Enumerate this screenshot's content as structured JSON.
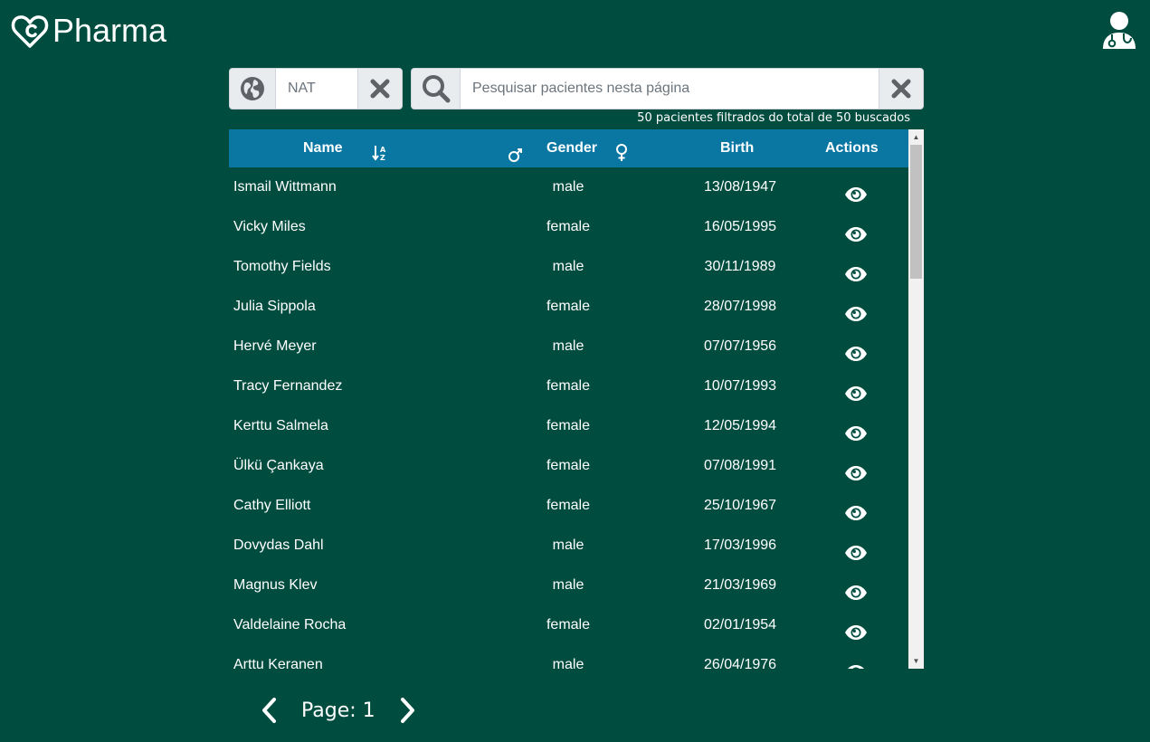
{
  "app": {
    "title": "Pharma"
  },
  "filters": {
    "country_value": "NAT",
    "search_placeholder": "Pesquisar pacientes nesta página"
  },
  "status": {
    "count_text": "50 pacientes filtrados do total de 50 buscados"
  },
  "table": {
    "headers": {
      "name": "Name",
      "gender": "Gender",
      "birth": "Birth",
      "actions": "Actions"
    },
    "rows": [
      {
        "name": "Ismail Wittmann",
        "gender": "male",
        "birth": "13/08/1947"
      },
      {
        "name": "Vicky Miles",
        "gender": "female",
        "birth": "16/05/1995"
      },
      {
        "name": "Tomothy Fields",
        "gender": "male",
        "birth": "30/11/1989"
      },
      {
        "name": "Julia Sippola",
        "gender": "female",
        "birth": "28/07/1998"
      },
      {
        "name": "Hervé Meyer",
        "gender": "male",
        "birth": "07/07/1956"
      },
      {
        "name": "Tracy Fernandez",
        "gender": "female",
        "birth": "10/07/1993"
      },
      {
        "name": "Kerttu Salmela",
        "gender": "female",
        "birth": "12/05/1994"
      },
      {
        "name": "Ülkü Çankaya",
        "gender": "female",
        "birth": "07/08/1991"
      },
      {
        "name": "Cathy Elliott",
        "gender": "female",
        "birth": "25/10/1967"
      },
      {
        "name": "Dovydas Dahl",
        "gender": "male",
        "birth": "17/03/1996"
      },
      {
        "name": "Magnus Klev",
        "gender": "male",
        "birth": "21/03/1969"
      },
      {
        "name": "Valdelaine Rocha",
        "gender": "female",
        "birth": "02/01/1954"
      },
      {
        "name": "Arttu Keranen",
        "gender": "male",
        "birth": "26/04/1976"
      }
    ]
  },
  "pagination": {
    "label": "Page: 1"
  },
  "icons": {
    "logo": "heart-c-icon",
    "user": "doctor-icon",
    "globe": "globe-icon",
    "clear": "close-icon",
    "search": "search-icon",
    "sort": "sort-alpha-down-icon",
    "male": "male-icon",
    "female": "female-icon",
    "view": "eye-icon",
    "prev": "chevron-left-icon",
    "next": "chevron-right-icon"
  },
  "colors": {
    "background": "#004d40",
    "header": "#0a77a3",
    "input_addon": "#e9ecef"
  }
}
